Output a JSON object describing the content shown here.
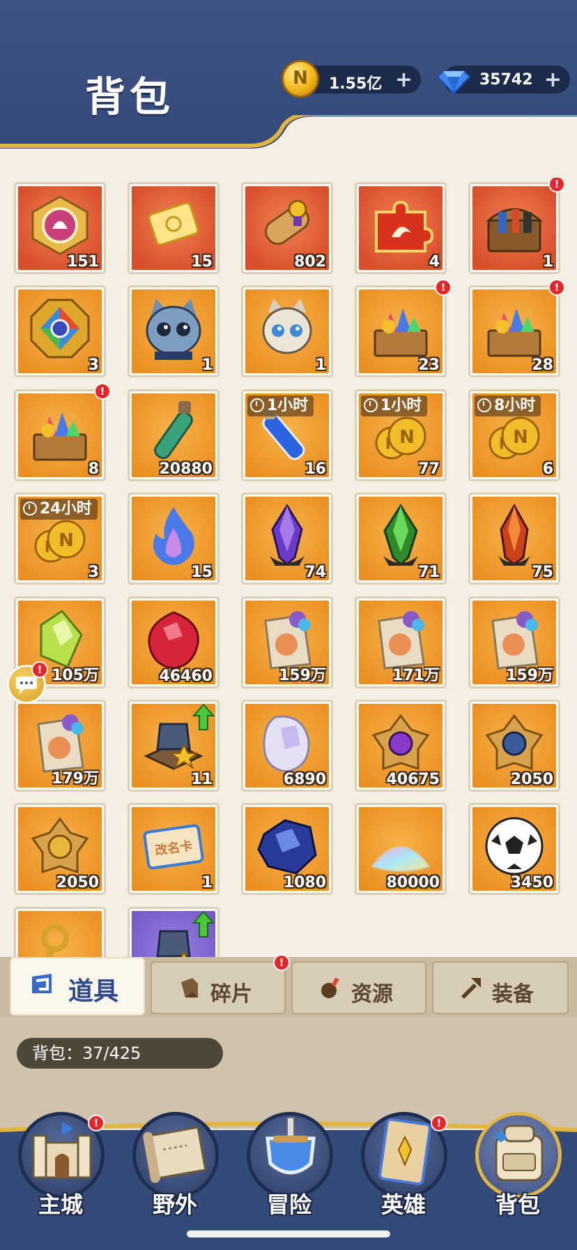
{
  "header": {
    "title": "背包"
  },
  "currency": {
    "gold": {
      "value": "1.55亿",
      "icon": "gold-coin-icon",
      "plus": "+"
    },
    "diamond": {
      "value": "35742",
      "icon": "diamond-icon",
      "plus": "+"
    }
  },
  "colors": {
    "header": "#3d5482",
    "accent_gold": "#e2b540",
    "badge_red": "#e6242a",
    "slot_orange": "#eb8f22",
    "slot_red": "#d94f2b"
  },
  "items": [
    {
      "id": "badge-medal",
      "icon": "amulet-icon",
      "bg": "red",
      "count": "151"
    },
    {
      "id": "golden-ticket",
      "icon": "golden-ticket-icon",
      "bg": "red",
      "count": "15"
    },
    {
      "id": "scroll",
      "icon": "scroll-icon",
      "bg": "red",
      "count": "802"
    },
    {
      "id": "puzzle-piece",
      "icon": "puzzle-piece-icon",
      "bg": "red",
      "count": "4"
    },
    {
      "id": "treasure-chest",
      "icon": "treasure-chest-icon",
      "bg": "red",
      "count": "1",
      "badge": "!"
    },
    {
      "id": "octagon-medal",
      "icon": "octagon-medal-icon",
      "bg": "orange",
      "count": "3"
    },
    {
      "id": "cat-pet",
      "icon": "cat-pet-icon",
      "bg": "orange",
      "count": "1"
    },
    {
      "id": "dragon-pet",
      "icon": "dragon-pet-icon",
      "bg": "orange",
      "count": "1"
    },
    {
      "id": "gem-chest-a",
      "icon": "gem-chest-icon",
      "bg": "orange",
      "count": "23",
      "badge": "!"
    },
    {
      "id": "gem-chest-b",
      "icon": "gem-chest-icon",
      "bg": "orange",
      "count": "28",
      "badge": "!"
    },
    {
      "id": "gem-chest-c",
      "icon": "gem-chest-icon",
      "bg": "orange",
      "count": "8",
      "badge": "!"
    },
    {
      "id": "green-vial",
      "icon": "green-vial-icon",
      "bg": "orange",
      "count": "20880"
    },
    {
      "id": "blue-potion",
      "icon": "blue-potion-icon",
      "bg": "orange",
      "count": "16",
      "timer": "1小时"
    },
    {
      "id": "coin-boost-1h",
      "icon": "coin-stack-icon",
      "bg": "orange",
      "count": "77",
      "timer": "1小时"
    },
    {
      "id": "coin-boost-8h",
      "icon": "coin-stack-icon",
      "bg": "orange",
      "count": "6",
      "timer": "8小时"
    },
    {
      "id": "coin-boost-24h",
      "icon": "coin-stack-icon",
      "bg": "orange",
      "count": "3",
      "timer": "24小时"
    },
    {
      "id": "blue-flame",
      "icon": "blue-flame-icon",
      "bg": "orange",
      "count": "15"
    },
    {
      "id": "purple-crystal",
      "icon": "purple-crystal-icon",
      "bg": "orange",
      "count": "74"
    },
    {
      "id": "green-crystal",
      "icon": "green-crystal-icon",
      "bg": "orange",
      "count": "71"
    },
    {
      "id": "red-crystal",
      "icon": "red-crystal-icon",
      "bg": "orange",
      "count": "75"
    },
    {
      "id": "green-gem",
      "icon": "green-gem-icon",
      "bg": "orange",
      "count": "105万"
    },
    {
      "id": "red-gem",
      "icon": "red-gem-icon",
      "bg": "orange",
      "count": "46460"
    },
    {
      "id": "dragon-seed-bag",
      "icon": "seed-bag-icon",
      "bg": "orange",
      "count": "159万"
    },
    {
      "id": "cat-seed-bag",
      "icon": "seed-bag-icon",
      "bg": "orange",
      "count": "171万"
    },
    {
      "id": "flame-seed-bag",
      "icon": "seed-bag-icon",
      "bg": "orange",
      "count": "159万"
    },
    {
      "id": "panda-seed-bag",
      "icon": "seed-bag-icon",
      "bg": "orange",
      "count": "179万"
    },
    {
      "id": "hero-armor",
      "icon": "armor-upgrade-icon",
      "bg": "orange",
      "count": "11",
      "upgrade": true
    },
    {
      "id": "white-stone",
      "icon": "white-stone-icon",
      "bg": "orange",
      "count": "6890"
    },
    {
      "id": "purple-rune",
      "icon": "purple-rune-icon",
      "bg": "orange",
      "count": "40675"
    },
    {
      "id": "blue-rune",
      "icon": "blue-rune-icon",
      "bg": "orange",
      "count": "2050"
    },
    {
      "id": "gold-rune",
      "icon": "gold-rune-icon",
      "bg": "orange",
      "count": "2050"
    },
    {
      "id": "rename-card",
      "icon": "rename-card-icon",
      "bg": "orange",
      "count": "1",
      "card_text": "改名卡"
    },
    {
      "id": "blue-ore",
      "icon": "blue-ore-icon",
      "bg": "orange",
      "count": "1080"
    },
    {
      "id": "rainbow-sand",
      "icon": "rainbow-sand-icon",
      "bg": "orange",
      "count": "80000"
    },
    {
      "id": "soccer-ball",
      "icon": "soccer-ball-icon",
      "bg": "orange",
      "count": "3450"
    },
    {
      "id": "gold-key",
      "icon": "key-icon",
      "bg": "orange",
      "count": ""
    },
    {
      "id": "purple-armor",
      "icon": "armor-upgrade-icon",
      "bg": "purple",
      "count": "",
      "upgrade": true
    }
  ],
  "tabs": [
    {
      "label": "道具",
      "icon": "item-tab-icon",
      "active": true
    },
    {
      "label": "碎片",
      "icon": "fragment-icon",
      "active": false,
      "badge": "!"
    },
    {
      "label": "资源",
      "icon": "resource-icon",
      "active": false
    },
    {
      "label": "装备",
      "icon": "equipment-icon",
      "active": false
    }
  ],
  "capacity": {
    "label": "背包：37/425"
  },
  "nav": [
    {
      "label": "主城",
      "icon": "castle-icon",
      "badge": "!"
    },
    {
      "label": "野外",
      "icon": "map-scroll-icon"
    },
    {
      "label": "冒险",
      "icon": "sword-shield-icon"
    },
    {
      "label": "英雄",
      "icon": "hero-card-icon",
      "badge": "!"
    },
    {
      "label": "背包",
      "icon": "backpack-icon",
      "active": true
    }
  ],
  "badge_symbol": "!"
}
